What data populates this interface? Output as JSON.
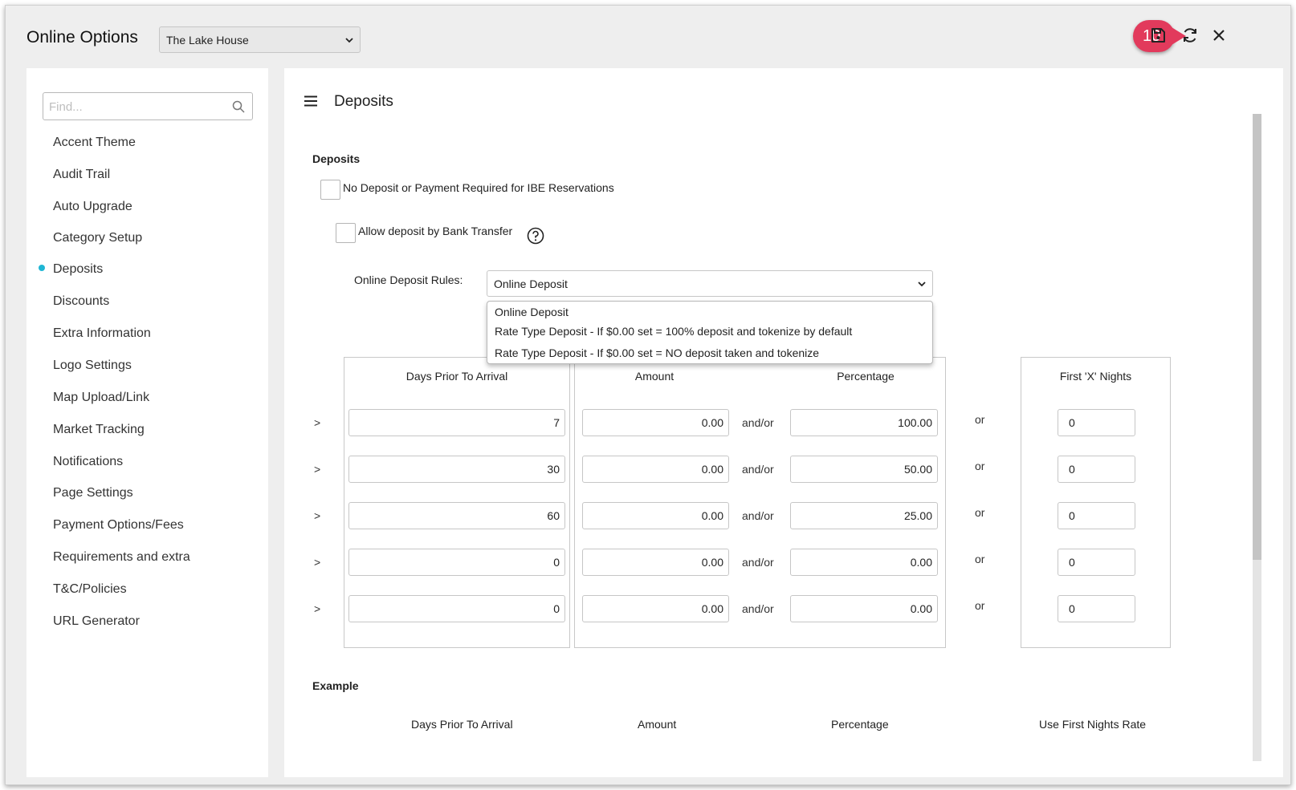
{
  "app": {
    "title": "Online Options",
    "property_select": "The Lake House",
    "step_badge": "10"
  },
  "toolbar": {
    "icons": [
      "save-icon",
      "refresh-icon",
      "close-icon"
    ]
  },
  "sidebar": {
    "search_placeholder": "Find...",
    "items": [
      {
        "label": "Accent Theme"
      },
      {
        "label": "Audit Trail"
      },
      {
        "label": "Auto Upgrade"
      },
      {
        "label": "Category Setup"
      },
      {
        "label": "Deposits",
        "active": true
      },
      {
        "label": "Discounts"
      },
      {
        "label": "Extra Information"
      },
      {
        "label": "Logo Settings"
      },
      {
        "label": "Map Upload/Link"
      },
      {
        "label": "Market Tracking"
      },
      {
        "label": "Notifications"
      },
      {
        "label": "Page Settings"
      },
      {
        "label": "Payment Options/Fees"
      },
      {
        "label": "Requirements and extra"
      },
      {
        "label": "T&C/Policies"
      },
      {
        "label": "URL Generator"
      }
    ],
    "active_color": "#1fb6d4"
  },
  "main": {
    "title": "Deposits",
    "section_title": "Deposits",
    "no_deposit_label": "No Deposit or Payment Required for IBE Reservations",
    "bank_transfer_label": "Allow deposit by Bank Transfer",
    "rules_label": "Online Deposit Rules:",
    "rules_value": "Online Deposit",
    "rules_options": [
      "Online Deposit",
      "Rate Type Deposit - If $0.00 set = 100% deposit and tokenize by default",
      "Rate Type Deposit - If $0.00 set = NO deposit taken and tokenize"
    ],
    "table": {
      "headers": {
        "days": "Days Prior To Arrival",
        "amount": "Amount",
        "percentage": "Percentage",
        "nights": "First 'X' Nights"
      },
      "row_prefix": ">",
      "and_or": "and/or",
      "or": "or",
      "rows": [
        {
          "days": "7",
          "amount": "0.00",
          "percentage": "100.00",
          "nights": "0"
        },
        {
          "days": "30",
          "amount": "0.00",
          "percentage": "50.00",
          "nights": "0"
        },
        {
          "days": "60",
          "amount": "0.00",
          "percentage": "25.00",
          "nights": "0"
        },
        {
          "days": "0",
          "amount": "0.00",
          "percentage": "0.00",
          "nights": "0"
        },
        {
          "days": "0",
          "amount": "0.00",
          "percentage": "0.00",
          "nights": "0"
        }
      ]
    },
    "example": {
      "title": "Example",
      "headers": {
        "days": "Days Prior To Arrival",
        "amount": "Amount",
        "percentage": "Percentage",
        "first_nights": "Use First Nights Rate"
      }
    }
  },
  "colors": {
    "badge": "#e23a5c",
    "window_bg": "#eeeeee"
  }
}
